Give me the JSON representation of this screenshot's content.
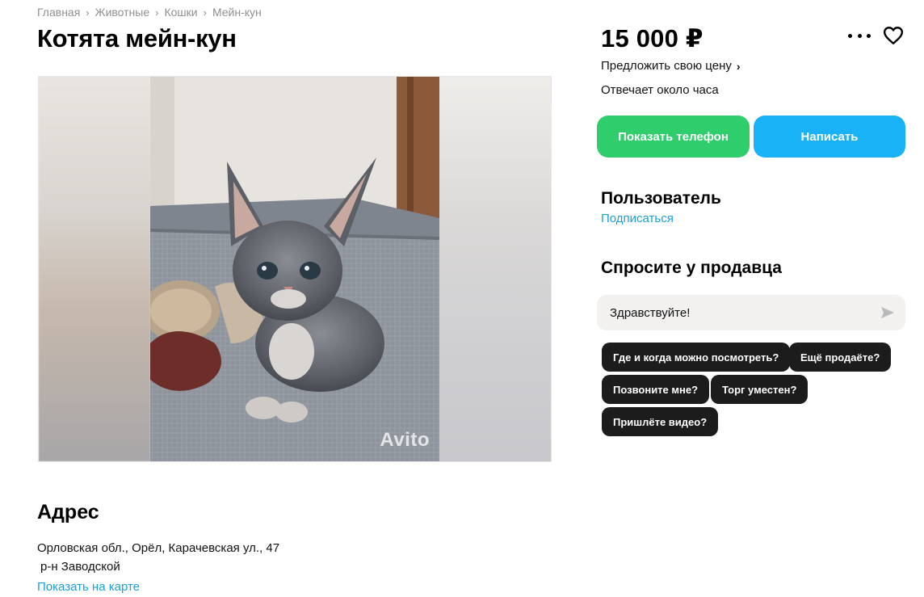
{
  "breadcrumbs": [
    "Главная",
    "Животные",
    "Кошки",
    "Мейн-кун"
  ],
  "breadcrumb_separator": "›",
  "listing": {
    "title": "Котята мейн-кун",
    "photo": {
      "subject": "grey kitten on a grey cushion",
      "watermark": "Avito"
    }
  },
  "address": {
    "heading": "Адрес",
    "line1": "Орловская обл., Орёл, Карачевская ул., 47",
    "line2": "р-н Заводской",
    "map_link": "Показать на карте"
  },
  "price": {
    "value": "15 000 ₽",
    "offer_link": "Предложить свою цену",
    "reply_time": "Отвечает около часа"
  },
  "actions": {
    "show_phone": "Показать телефон",
    "write": "Написать"
  },
  "seller": {
    "name": "Пользователь",
    "subscribe": "Подписаться"
  },
  "ask_seller": {
    "heading": "Спросите у продавца",
    "message_value": "Здравствуйте!",
    "quick_questions": [
      "Где и когда можно посмотреть?",
      "Ещё продаёте?",
      "Позвоните мне?",
      "Торг уместен?",
      "Пришлёте видео?"
    ]
  },
  "icons": {
    "more": "more-icon",
    "favorite": "heart-icon",
    "send": "send-icon",
    "chevron": "chevron-right-icon"
  },
  "colors": {
    "phone_button": "#2fcd6b",
    "write_button": "#1ab2f7",
    "link": "#1a9fd6",
    "chip": "#1c1c1c",
    "message_box": "#f2f1f0"
  }
}
